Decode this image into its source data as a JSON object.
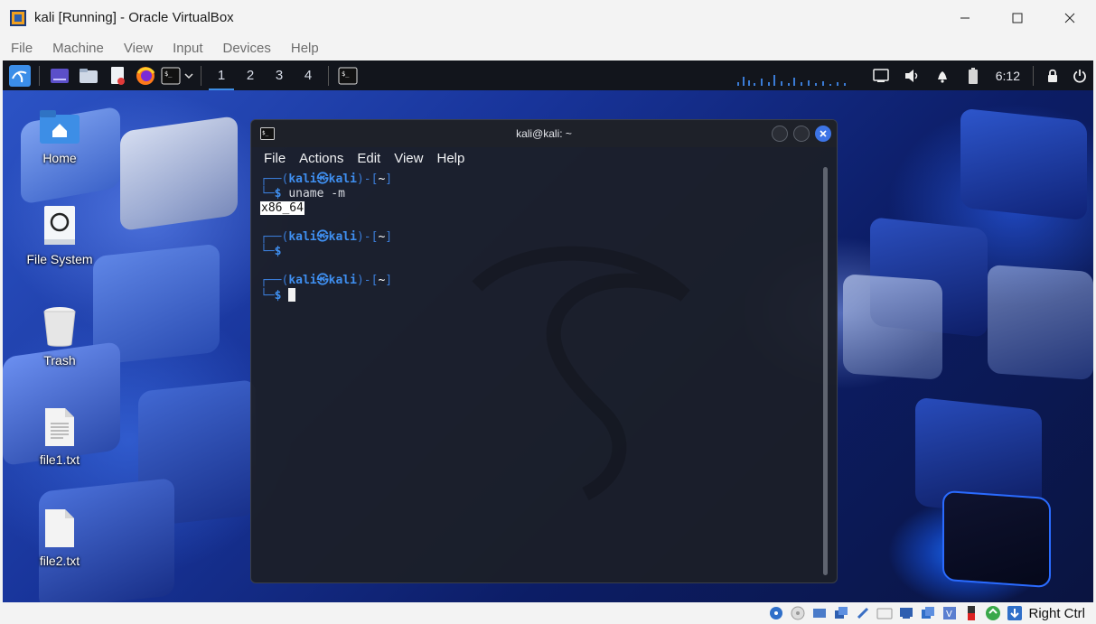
{
  "vbox": {
    "title": "kali [Running] - Oracle VirtualBox",
    "menu": [
      "File",
      "Machine",
      "View",
      "Input",
      "Devices",
      "Help"
    ],
    "host_key": "Right Ctrl"
  },
  "panel": {
    "workspaces": [
      "1",
      "2",
      "3",
      "4"
    ],
    "active_workspace": "1",
    "clock": "6:12"
  },
  "desktop": {
    "icons": [
      {
        "label": "Home",
        "icon": "folder-home-icon"
      },
      {
        "label": "File System",
        "icon": "drive-icon"
      },
      {
        "label": "Trash",
        "icon": "trash-icon"
      },
      {
        "label": "file1.txt",
        "icon": "text-file-icon"
      },
      {
        "label": "file2.txt",
        "icon": "text-file-icon"
      }
    ]
  },
  "terminal": {
    "title": "kali@kali: ~",
    "menu": [
      "File",
      "Actions",
      "Edit",
      "View",
      "Help"
    ],
    "prompt_user": "kali",
    "prompt_at": "㉿",
    "prompt_host": "kali",
    "prompt_dir": "~",
    "command1": "uname -m",
    "output1": "x86_64"
  }
}
